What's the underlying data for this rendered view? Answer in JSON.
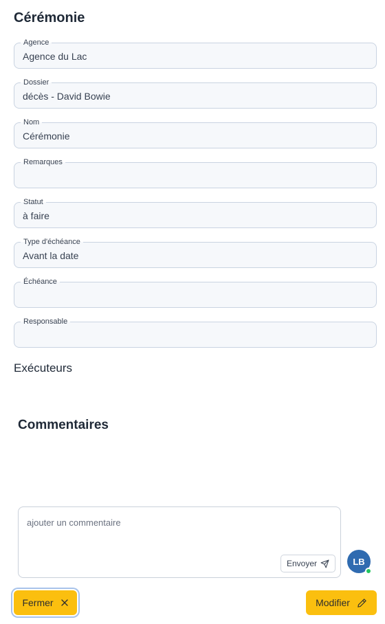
{
  "page": {
    "title": "Cérémonie"
  },
  "fields": [
    {
      "label": "Agence",
      "value": "Agence du Lac"
    },
    {
      "label": "Dossier",
      "value": "décès - David Bowie"
    },
    {
      "label": "Nom",
      "value": "Cérémonie"
    },
    {
      "label": "Remarques",
      "value": ""
    },
    {
      "label": "Statut",
      "value": "à faire"
    },
    {
      "label": "Type d'échéance",
      "value": "Avant la date"
    },
    {
      "label": "Échéance",
      "value": ""
    },
    {
      "label": "Responsable",
      "value": ""
    }
  ],
  "executors": {
    "heading": "Exécuteurs"
  },
  "comments": {
    "heading": "Commentaires",
    "placeholder": "ajouter un commentaire",
    "send_label": "Envoyer",
    "send_icon": "paper-plane-icon"
  },
  "user": {
    "initials": "LB",
    "status": "online",
    "avatar_color": "#2f6bb0",
    "status_color": "#22c55e"
  },
  "footer": {
    "close_label": "Fermer",
    "close_icon": "close-icon",
    "edit_label": "Modifier",
    "edit_icon": "pencil-icon",
    "accent_color": "#fbbf0f"
  }
}
